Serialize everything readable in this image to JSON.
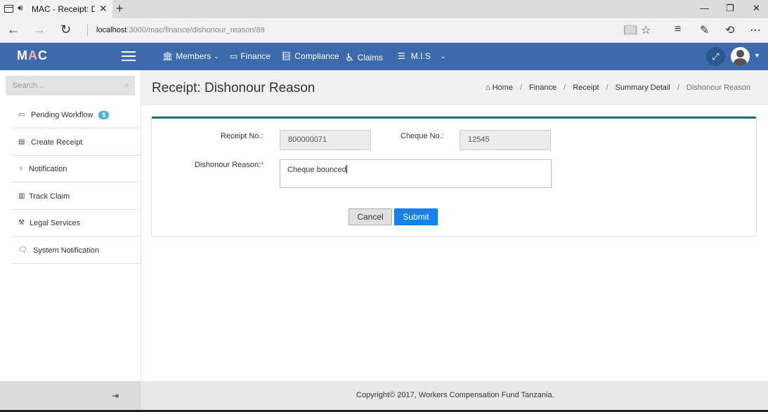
{
  "browser": {
    "tab_title": "MAC - Receipt: Dish",
    "tab_audio_icon": "speaker-icon",
    "url_host": "localhost",
    "url_path": ":3000/mac/finance/dishonour_reason/89"
  },
  "app": {
    "logo_left": "M",
    "logo_mid": "A",
    "logo_right": "C",
    "menu": [
      {
        "label": "Members",
        "icon": "bank-icon",
        "has_dropdown": true
      },
      {
        "label": "Finance",
        "icon": "money-icon",
        "has_dropdown": false
      },
      {
        "label": "Compliance",
        "icon": "book-icon",
        "has_dropdown": false
      },
      {
        "label": "Claims",
        "icon": "wheelchair-icon",
        "has_dropdown": false
      },
      {
        "label": "M.I.S",
        "icon": "list-icon",
        "has_dropdown": true
      }
    ]
  },
  "sidebar": {
    "search_placeholder": "Search...",
    "items": [
      {
        "label": "Pending Workflow",
        "icon": "inbox-icon",
        "badge": "5"
      },
      {
        "label": "Create Receipt",
        "icon": "receipt-icon"
      },
      {
        "label": "Notification",
        "icon": "bell-icon"
      },
      {
        "label": "Track Claim",
        "icon": "chart-icon"
      },
      {
        "label": "Legal Services",
        "icon": "gavel-icon"
      },
      {
        "label": "System Notification",
        "icon": "comment-icon"
      }
    ]
  },
  "page": {
    "title": "Receipt: Dishonour Reason",
    "breadcrumb": [
      "Home",
      "Finance",
      "Receipt",
      "Summary Detail",
      "Dishonour Reason"
    ]
  },
  "form": {
    "receipt_no_label": "Receipt No.:",
    "receipt_no_value": "800000071",
    "cheque_no_label": "Cheque No.:",
    "cheque_no_value": "12545",
    "dishonour_label": "Dishonour Reason:",
    "required_mark": "*",
    "dishonour_value": "Cheque bounced",
    "cancel_label": "Cancel",
    "submit_label": "Submit"
  },
  "footer": {
    "copyright": "Copyright© 2017, Workers Compensation Fund Tanzania."
  },
  "colors": {
    "header_bg": "#3d6aaa",
    "panel_accent": "#1f6b7a",
    "submit_bg": "#0d84ef",
    "badge_bg": "#4ab3d6"
  }
}
